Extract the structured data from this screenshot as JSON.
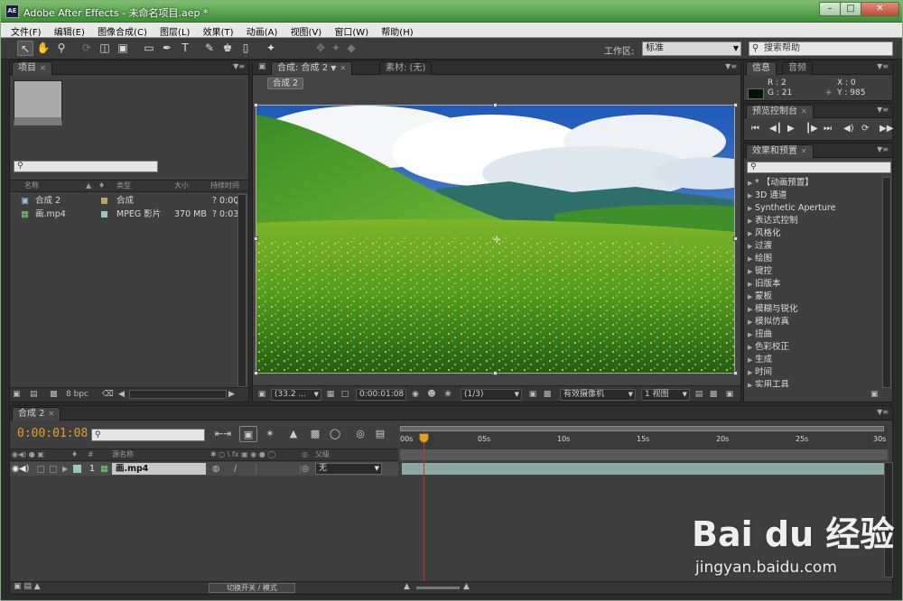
{
  "window": {
    "title": "Adobe After Effects - 未命名项目.aep *",
    "app_icon": "AE"
  },
  "menu": [
    "文件(F)",
    "编辑(E)",
    "图像合成(C)",
    "图层(L)",
    "效果(T)",
    "动画(A)",
    "视图(V)",
    "窗口(W)",
    "帮助(H)"
  ],
  "toolbar": {
    "workspace_label": "工作区:",
    "workspace_value": "标准",
    "search_help": "搜索帮助"
  },
  "project_panel": {
    "tab": "项目",
    "columns": [
      "名称",
      "类型",
      "大小",
      "持续时间"
    ],
    "items": [
      {
        "name": "合成 2",
        "type": "合成",
        "size": "",
        "duration": "? 0:00",
        "color": "#b7a66a"
      },
      {
        "name": "画.mp4",
        "type": "MPEG 影片",
        "size": "370 MB",
        "duration": "? 0:03",
        "color": "#9bc7c0"
      }
    ],
    "bit_depth": "8 bpc"
  },
  "comp_panel": {
    "tab": "合成: 合成 2",
    "tab_footage": "素材: (无)",
    "breadcrumb": "合成 2",
    "zoom": "(33.2 ...",
    "timecode": "0:00:01:08",
    "resolution": "(1/3)",
    "camera": "有效摄像机",
    "views": "1 视图"
  },
  "info_panel": {
    "tab_info": "信息",
    "tab_audio": "音频",
    "r": "R : 2",
    "g": "G : 21",
    "x": "X : 0",
    "y": "Y : 985",
    "color_swatch": "#021507"
  },
  "preview_panel": {
    "tab": "预览控制台"
  },
  "effects_panel": {
    "tab": "效果和预置",
    "items": [
      "* 【动画预置】",
      "3D 通道",
      "Synthetic Aperture",
      "表达式控制",
      "风格化",
      "过渡",
      "绘图",
      "键控",
      "旧版本",
      "蒙板",
      "模糊与锐化",
      "模拟仿真",
      "扭曲",
      "色彩校正",
      "生成",
      "时间",
      "实用工具"
    ]
  },
  "timeline_panel": {
    "tab": "合成 2",
    "current_time": "0:00:01:08",
    "columns": [
      "#",
      "源名称",
      "父级"
    ],
    "ruler": [
      "00s",
      "05s",
      "10s",
      "15s",
      "20s",
      "25s",
      "30s"
    ],
    "layer": {
      "index": "1",
      "name": "画.mp4",
      "parent": "无"
    },
    "toggle_label": "切换开关 / 模式"
  },
  "watermark": {
    "logo": "Bai du 经验",
    "url": "jingyan.baidu.com"
  }
}
